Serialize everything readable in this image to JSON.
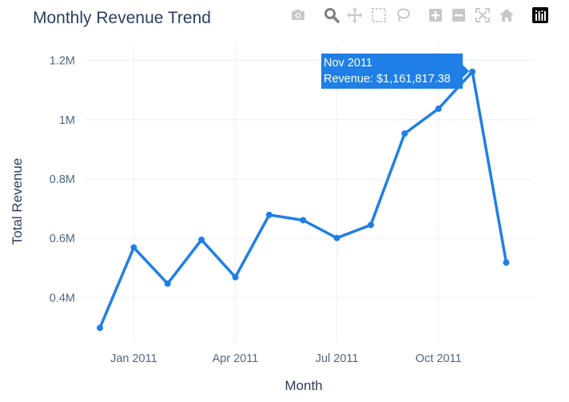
{
  "chart_title": "Monthly Revenue Trend",
  "tooltip": {
    "title": "Nov 2011",
    "label": "Revenue: $1,161,817.38"
  },
  "modebar": [
    {
      "name": "camera-icon",
      "active": false
    },
    {
      "name": "zoom-icon",
      "active": true
    },
    {
      "name": "pan-icon",
      "active": false
    },
    {
      "name": "box-select-icon",
      "active": false
    },
    {
      "name": "lasso-select-icon",
      "active": false
    },
    {
      "name": "zoom-in-icon",
      "active": false
    },
    {
      "name": "zoom-out-icon",
      "active": false
    },
    {
      "name": "autoscale-icon",
      "active": false
    },
    {
      "name": "reset-axes-icon",
      "active": false
    },
    {
      "name": "plotly-logo-icon",
      "active": false
    }
  ],
  "colors": {
    "line": "#1f7fe6",
    "text": "#2a3f5f",
    "grid": "#ebf0f8",
    "tick_text": "#506784",
    "modebar": "#c8c8c8",
    "modebar_active": "#7f7f7f"
  },
  "chart_data": {
    "type": "line",
    "title": "Monthly Revenue Trend",
    "xlabel": "Month",
    "ylabel": "Total Revenue",
    "x": [
      "2010-12",
      "2011-01",
      "2011-02",
      "2011-03",
      "2011-04",
      "2011-05",
      "2011-06",
      "2011-07",
      "2011-08",
      "2011-09",
      "2011-10",
      "2011-11",
      "2011-12"
    ],
    "values": [
      298000,
      569000,
      447000,
      595000,
      469000,
      679000,
      661000,
      601000,
      645000,
      953000,
      1037000,
      1161817.38,
      518000
    ],
    "ylim": [
      250000,
      1250000
    ],
    "y_ticks": [
      400000,
      600000,
      800000,
      1000000,
      1200000
    ],
    "y_tick_labels": [
      "0.4M",
      "0.6M",
      "0.8M",
      "1M",
      "1.2M"
    ],
    "x_tick_labels": [
      "Jan 2011",
      "Apr 2011",
      "Jul 2011",
      "Oct 2011"
    ],
    "x_tick_indices": [
      1,
      4,
      7,
      10
    ],
    "grid": true,
    "legend": false,
    "highlight_index": 11
  }
}
